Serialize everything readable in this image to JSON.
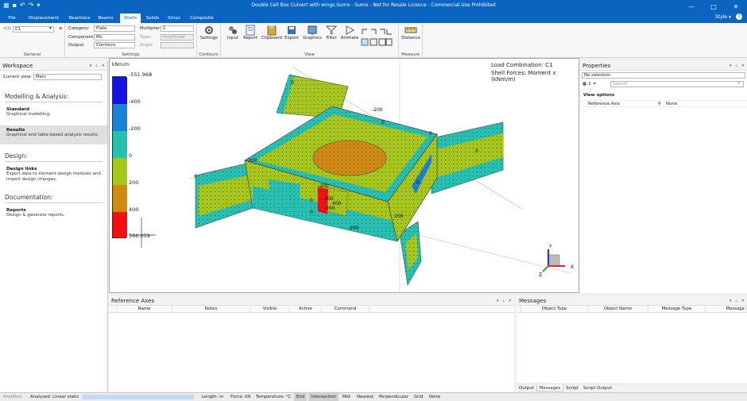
{
  "app": {
    "title": "Double Cell Box Culvert with wings.Sumo - Sumo - Not for Resale Licence - Commercial Use Prohibited",
    "style_label": "Style",
    "help": "?"
  },
  "tabs": [
    "File",
    "Displacement",
    "Reactions",
    "Beams",
    "Shells",
    "Solids",
    "Strips",
    "Composite"
  ],
  "active_tab": "Shells",
  "ribbon": {
    "general": {
      "value": "C1",
      "label": "General"
    },
    "settings": {
      "category_label": "Category:",
      "category": "Plate",
      "component_label": "Component:",
      "component": "Mx",
      "output_label": "Output:",
      "output": "Contours",
      "multiplier_label": "Multiplier:",
      "multiplier": "1",
      "type_label": "Type:",
      "type": "Amplitude",
      "angle_label": "Angle:",
      "label": "Settings"
    },
    "contours": {
      "settings_btn": "Settings",
      "label": "Contours"
    },
    "view": {
      "buttons": [
        "Input",
        "Report",
        "Clipboard",
        "Export",
        "Graphics",
        "Filter",
        "Animate"
      ],
      "label": "View"
    },
    "measure": {
      "distance_btn": "Distance",
      "label": "Measure"
    }
  },
  "workspace": {
    "title": "Workspace",
    "current_view_label": "Current view:",
    "current_view": "Main",
    "sections": [
      {
        "heading": "Modelling & Analysis:",
        "items": [
          {
            "title": "Standard",
            "desc": "Graphical modelling.",
            "selected": false
          },
          {
            "title": "Results",
            "desc": "Graphical and table-based analysis results.",
            "selected": true
          }
        ]
      },
      {
        "heading": "Design:",
        "items": [
          {
            "title": "Design links",
            "desc": "Export data to element design modules and import design changes.",
            "selected": false
          }
        ]
      },
      {
        "heading": "Documentation:",
        "items": [
          {
            "title": "Reports",
            "desc": "Design & generate reports.",
            "selected": false
          }
        ]
      }
    ]
  },
  "viewport": {
    "load_combination": "Load Combination: C1",
    "shell_forces": "Shell Forces: Moment x (kNm/m)",
    "legend_unit": "kNm/m",
    "legend_values": [
      "-551.968",
      "-400",
      "-200",
      "0",
      "200",
      "400",
      "566.059"
    ],
    "legend_colors": [
      "#1515e0",
      "#1a82d4",
      "#25c0b2",
      "#a6c61a",
      "#d08a10",
      "#f21010"
    ],
    "contour_labels": [
      "0",
      "-200",
      "0",
      "200",
      "-200",
      "0",
      "0",
      "-200",
      "400",
      "200",
      "-200",
      "0",
      "0",
      "0",
      "200",
      "0"
    ],
    "axes": {
      "x": "X",
      "y": "Y",
      "z": "Z"
    }
  },
  "properties": {
    "title": "Properties",
    "selection": "No selection",
    "search_placeholder": "Search",
    "view_options": "View options",
    "reference_axis_label": "Reference Axis",
    "reference_axis_value": "None"
  },
  "reference_axes": {
    "title": "Reference Axes",
    "columns": [
      "Name",
      "Notes",
      "Visible",
      "Active",
      "Command"
    ]
  },
  "messages": {
    "title": "Messages",
    "columns": [
      "Object Type",
      "Object Name",
      "Message Type",
      "Message"
    ],
    "tabs": [
      "Output",
      "Messages",
      "Script",
      "Script Output"
    ],
    "active_tab": "Messages"
  },
  "status": {
    "modified": "Modified",
    "analysis": "Analysed: Linear static",
    "length": "Length: m",
    "force": "Force: kN",
    "temperature": "Temperature: °C",
    "snaps": [
      "End",
      "Intersection",
      "Mid",
      "Nearest",
      "Perpendicular",
      "Grid",
      "None"
    ],
    "snaps_on": [
      "End",
      "Intersection"
    ]
  }
}
